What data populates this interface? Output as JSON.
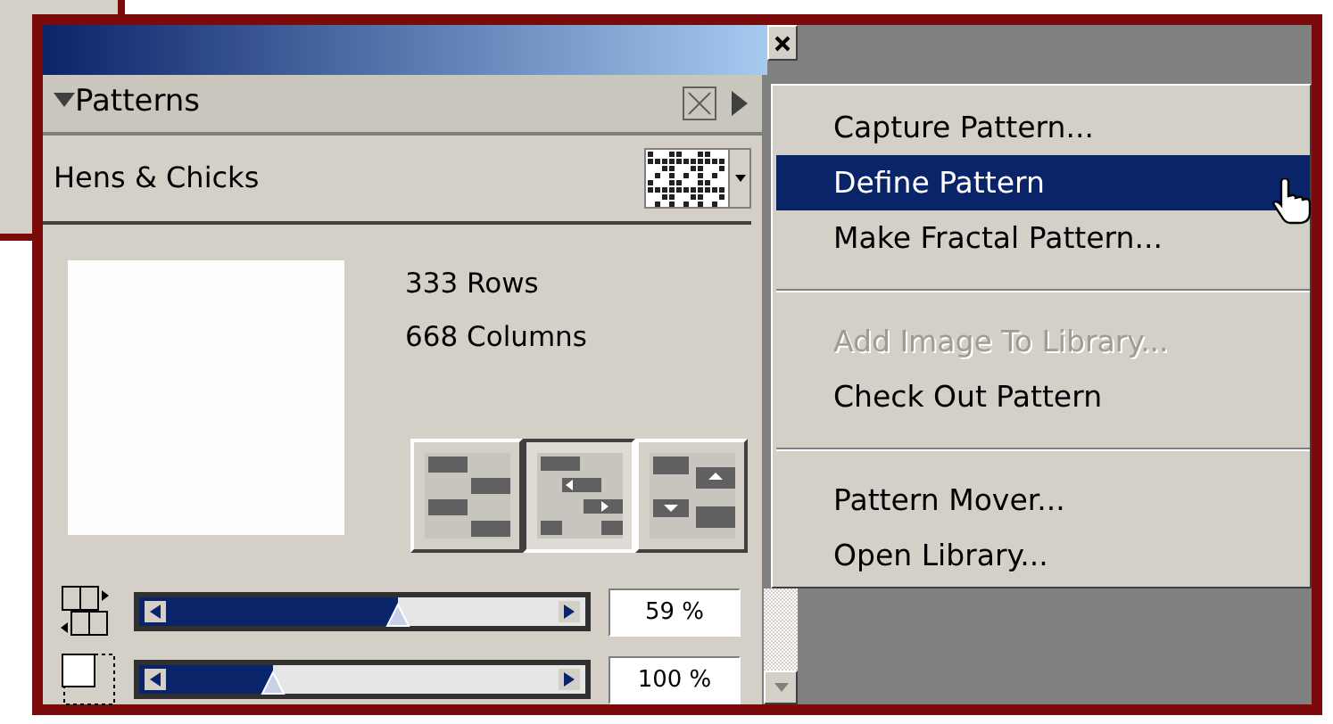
{
  "panel": {
    "title": "Patterns",
    "expanded": true,
    "pattern_name": "Hens & Chicks",
    "rows": "333 Rows",
    "columns": "668 Columns",
    "tile_modes": [
      {
        "kind": "brick",
        "selected": false
      },
      {
        "kind": "hshift",
        "selected": true
      },
      {
        "kind": "vshift",
        "selected": false
      }
    ],
    "sliders": [
      {
        "kind": "offset",
        "level": 0.58,
        "reading": "59 %"
      },
      {
        "kind": "size",
        "level": 0.3,
        "reading": "100 %"
      }
    ]
  },
  "menu": {
    "items": [
      {
        "kind": "item",
        "label": "Capture Pattern...",
        "disabled": false,
        "selected": false
      },
      {
        "kind": "item",
        "label": "Define Pattern",
        "disabled": false,
        "selected": true
      },
      {
        "kind": "item",
        "label": "Make Fractal Pattern...",
        "disabled": false,
        "selected": false
      },
      {
        "kind": "separator"
      },
      {
        "kind": "item",
        "label": "Add Image To Library...",
        "disabled": true,
        "selected": false
      },
      {
        "kind": "item",
        "label": "Check Out Pattern",
        "disabled": false,
        "selected": false
      },
      {
        "kind": "separator"
      },
      {
        "kind": "item",
        "label": "Pattern Mover...",
        "disabled": false,
        "selected": false
      },
      {
        "kind": "item",
        "label": "Open Library...",
        "disabled": false,
        "selected": false
      }
    ]
  }
}
